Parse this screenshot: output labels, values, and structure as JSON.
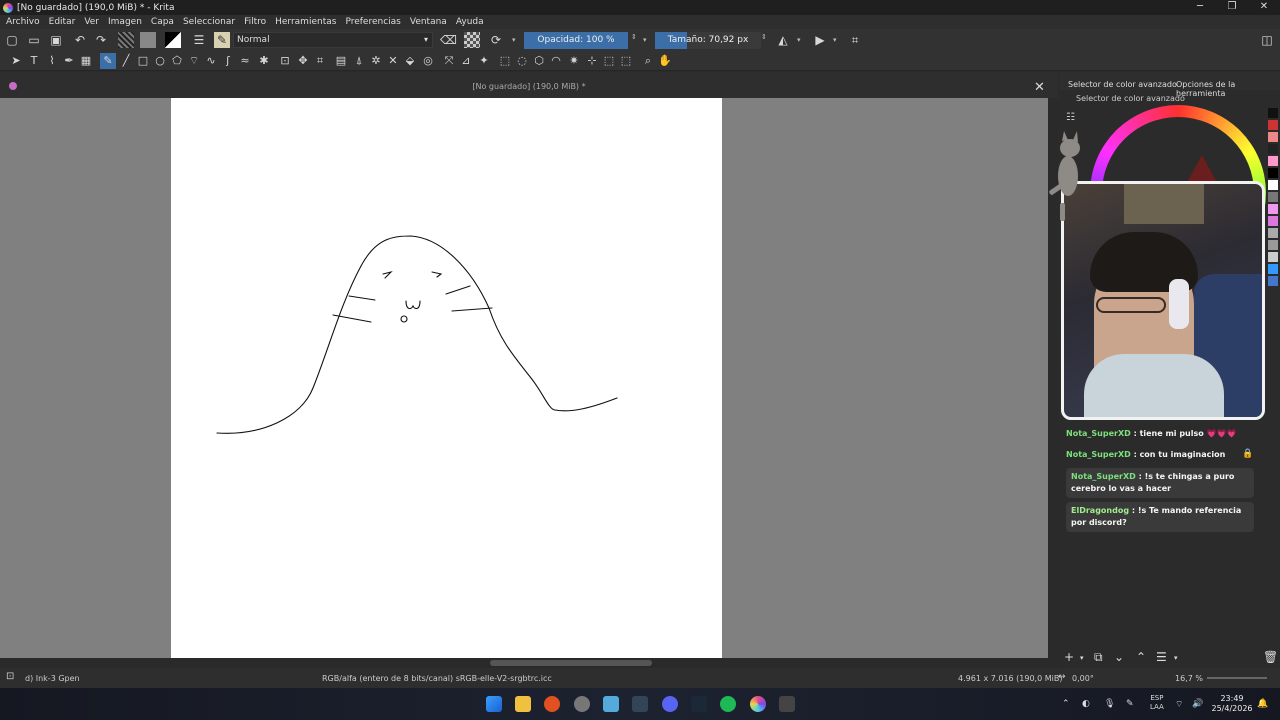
{
  "window": {
    "title": "[No guardado]  (190,0 MiB) * - Krita",
    "controls": [
      "─",
      "❐",
      "✕"
    ]
  },
  "menu": [
    "Archivo",
    "Editar",
    "Ver",
    "Imagen",
    "Capa",
    "Seleccionar",
    "Filtro",
    "Herramientas",
    "Preferencias",
    "Ventana",
    "Ayuda"
  ],
  "toolbar": {
    "blend_mode": "Normal",
    "opacity": "Opacidad: 100 %",
    "size": "Tamaño: 70,92 px",
    "opacity_level": 1.0
  },
  "document": {
    "title": "[No guardado]  (190,0 MiB) *"
  },
  "dock": {
    "tab1": "Selector de color avanzado",
    "tab2": "Opciones de la herramienta",
    "subtitle": "Selector de color avanzado"
  },
  "chat": [
    {
      "user": "Nota_SuperXD",
      "text": ": tiene mi pulso 💗💗💗"
    },
    {
      "user": "Nota_SuperXD",
      "text": ": con tu imaginacion"
    },
    {
      "user": "Nota_SuperXD",
      "text": ": !s te chingas a puro cerebro lo vas a hacer"
    },
    {
      "user": "ElDragondog",
      "text": ": !s Te mando referencia por discord?"
    }
  ],
  "status": {
    "brush": "d) Ink-3 Gpen",
    "color_space": "RGB/alfa (entero de 8 bits/canal)  sRGB-elle-V2-srgbtrc.icc",
    "dimensions": "4.961 x 7.016 (190,0 MiB)",
    "rotation": "0,00°",
    "zoom": "16,7 %"
  },
  "taskbar": {
    "lang": "ESP",
    "lang2": "LAA",
    "time": "23:49",
    "date": "25/4/2026"
  },
  "colors": {
    "accent": "#3c6fa8",
    "chat_user": "#7de07d"
  }
}
